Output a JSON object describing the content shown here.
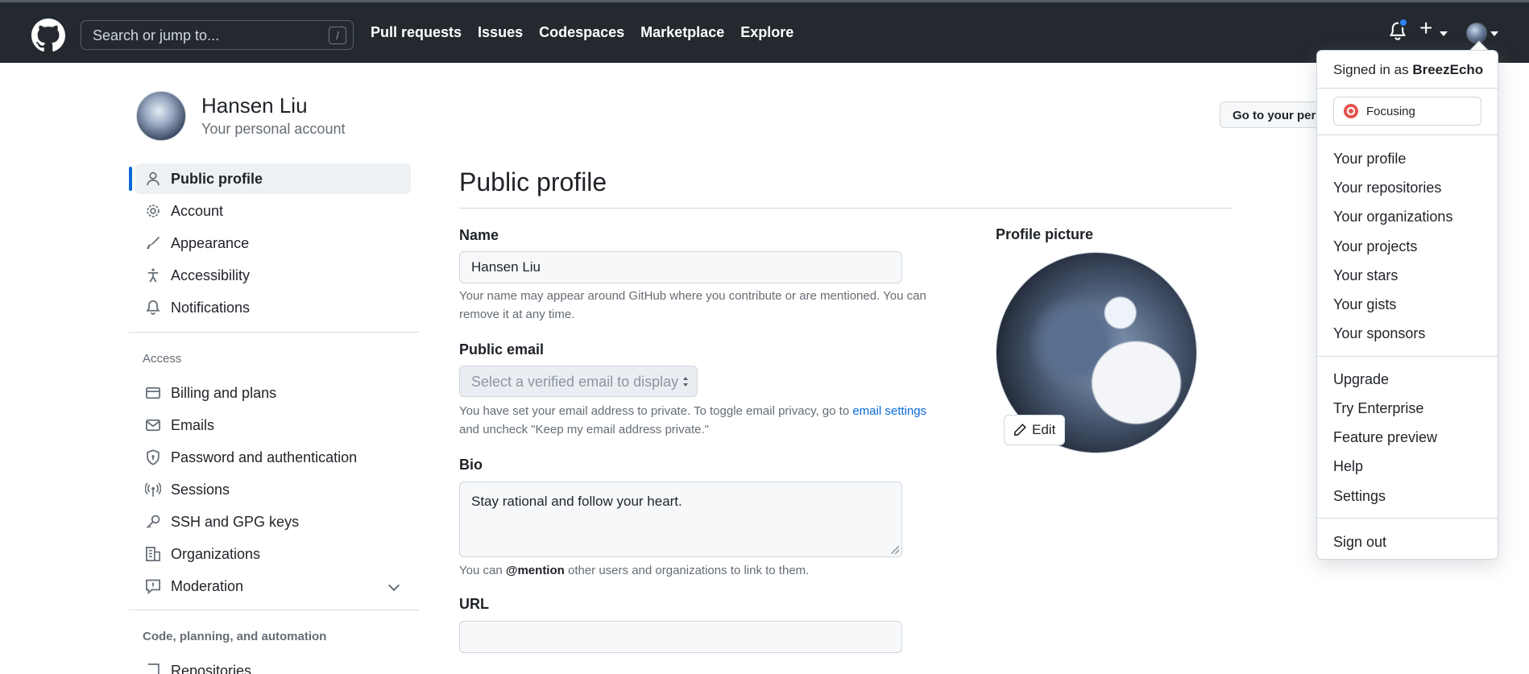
{
  "header": {
    "search_placeholder": "Search or jump to...",
    "search_shortcut": "/",
    "nav": [
      "Pull requests",
      "Issues",
      "Codespaces",
      "Marketplace",
      "Explore"
    ],
    "plus": "+"
  },
  "account": {
    "name": "Hansen Liu",
    "subtitle": "Your personal account",
    "go_button": "Go to your personal profile"
  },
  "sidebar": {
    "items": [
      {
        "label": "Public profile",
        "icon": "person-icon",
        "active": true
      },
      {
        "label": "Account",
        "icon": "gear-icon"
      },
      {
        "label": "Appearance",
        "icon": "paintbrush-icon"
      },
      {
        "label": "Accessibility",
        "icon": "accessibility-icon"
      },
      {
        "label": "Notifications",
        "icon": "bell-icon"
      }
    ],
    "access_heading": "Access",
    "access_items": [
      {
        "label": "Billing and plans",
        "icon": "credit-card-icon"
      },
      {
        "label": "Emails",
        "icon": "mail-icon"
      },
      {
        "label": "Password and authentication",
        "icon": "shield-lock-icon"
      },
      {
        "label": "Sessions",
        "icon": "broadcast-icon"
      },
      {
        "label": "SSH and GPG keys",
        "icon": "key-icon"
      },
      {
        "label": "Organizations",
        "icon": "organization-icon"
      },
      {
        "label": "Moderation",
        "icon": "report-icon"
      }
    ],
    "code_heading": "Code, planning, and automation",
    "code_items": [
      {
        "label": "Repositories",
        "icon": "repo-icon"
      }
    ]
  },
  "main": {
    "title": "Public profile",
    "name_label": "Name",
    "name_value": "Hansen Liu",
    "name_note": "Your name may appear around GitHub where you contribute or are mentioned. You can remove it at any time.",
    "email_label": "Public email",
    "email_placeholder": "Select a verified email to display",
    "email_note_1": "You have set your email address to private. To toggle email privacy, go to",
    "email_note_link": "email settings",
    "email_note_2": "and uncheck \"Keep my email address private.\"",
    "bio_label": "Bio",
    "bio_value": "Stay rational and follow your heart.",
    "bio_note_1": "You can",
    "bio_note_mention": "@mention",
    "bio_note_2": "other users and organizations to link to them.",
    "url_label": "URL",
    "url_value": "",
    "profile_picture_label": "Profile picture",
    "edit_button": "Edit"
  },
  "dropdown": {
    "signed_in_prefix": "Signed in as",
    "username": "BreezEcho",
    "status": "Focusing",
    "group1": [
      "Your profile",
      "Your repositories",
      "Your organizations",
      "Your projects",
      "Your stars",
      "Your gists",
      "Your sponsors"
    ],
    "group2": [
      "Upgrade",
      "Try Enterprise",
      "Feature preview",
      "Help",
      "Settings"
    ],
    "sign_out": "Sign out"
  },
  "colors": {
    "header_bg": "#24292f",
    "accent": "#0969da",
    "notification_dot": "#2f81f7"
  }
}
